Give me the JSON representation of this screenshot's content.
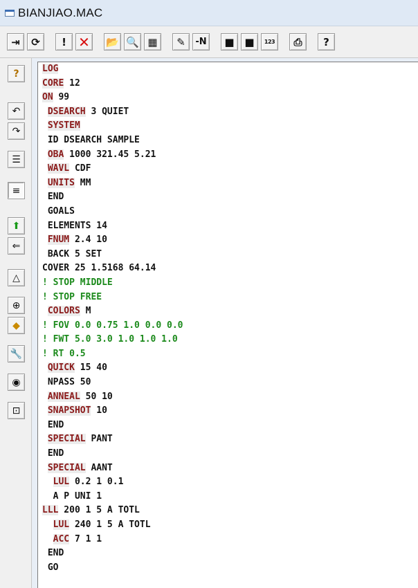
{
  "window": {
    "title": "BIANJIAO.MAC"
  },
  "toolbar": {
    "buttons": [
      {
        "name": "exit-button",
        "icon": "exit-icon",
        "glyph": "⇥",
        "cls": ""
      },
      {
        "name": "refresh-button",
        "icon": "refresh-icon",
        "glyph": "⟳",
        "cls": ""
      },
      {
        "name": "alert-button",
        "icon": "exclamation-icon",
        "glyph": "!",
        "cls": ""
      },
      {
        "name": "stop-button",
        "icon": "red-x-icon",
        "glyph": "✕",
        "cls": "red"
      },
      {
        "name": "open-folder-button",
        "icon": "open-folder-icon",
        "glyph": "📂",
        "cls": ""
      },
      {
        "name": "find-button",
        "icon": "magnifier-icon",
        "glyph": "🔍",
        "cls": ""
      },
      {
        "name": "macro-button",
        "icon": "macro-icon",
        "glyph": "▦",
        "cls": ""
      },
      {
        "name": "edit-button",
        "icon": "edit-icon",
        "glyph": "✎",
        "cls": ""
      },
      {
        "name": "line-number-button",
        "icon": "minus-n-icon",
        "glyph": "-N",
        "cls": "txt"
      },
      {
        "name": "save-button",
        "icon": "floppy-icon",
        "glyph": "■",
        "cls": ""
      },
      {
        "name": "save-as-button",
        "icon": "floppy-as-icon",
        "glyph": "■",
        "cls": ""
      },
      {
        "name": "numbers-button",
        "icon": "numbers-123-icon",
        "glyph": "123",
        "cls": "small"
      },
      {
        "name": "print-button",
        "icon": "printer-icon",
        "glyph": "⎙",
        "cls": ""
      },
      {
        "name": "help-button",
        "icon": "question-icon",
        "glyph": "?",
        "cls": ""
      }
    ]
  },
  "sidebar": {
    "buttons": [
      {
        "name": "help-button-side",
        "icon": "yellow-question-icon",
        "glyph": "?"
      },
      {
        "name": "undo-button",
        "icon": "undo-icon",
        "glyph": "↶"
      },
      {
        "name": "redo-button",
        "icon": "redo-icon",
        "glyph": "↷"
      },
      {
        "name": "indent-button",
        "icon": "indent-icon",
        "glyph": "☰"
      },
      {
        "name": "align-button",
        "icon": "align-lines-icon",
        "glyph": "≡"
      },
      {
        "name": "move-up-button",
        "icon": "green-up-arrow-icon",
        "glyph": "⬆"
      },
      {
        "name": "import-button",
        "icon": "import-icon",
        "glyph": "⇐"
      },
      {
        "name": "lens-button",
        "icon": "triangle-icon",
        "glyph": "△"
      },
      {
        "name": "target-button",
        "icon": "target-icon",
        "glyph": "⊕"
      },
      {
        "name": "gem-button",
        "icon": "gem-icon",
        "glyph": "◆"
      },
      {
        "name": "wrench-button",
        "icon": "wrench-icon",
        "glyph": "🔧"
      },
      {
        "name": "view-button",
        "icon": "eye-icon",
        "glyph": "◉"
      },
      {
        "name": "frame-button",
        "icon": "frame-icon",
        "glyph": "⊡"
      }
    ]
  },
  "editor": {
    "lines": [
      {
        "i": "",
        "k": "LOG",
        "r": "",
        "c": false
      },
      {
        "i": "",
        "k": "CORE",
        "r": " 12",
        "c": false
      },
      {
        "i": "",
        "k": "ON",
        "r": " 99",
        "c": false
      },
      {
        "i": " ",
        "k": "DSEARCH",
        "r": " 3 QUIET",
        "c": false
      },
      {
        "i": " ",
        "k": "SYSTEM",
        "r": "",
        "c": false
      },
      {
        "i": " ",
        "k": "",
        "r": "ID DSEARCH SAMPLE",
        "c": false
      },
      {
        "i": " ",
        "k": "OBA",
        "r": " 1000 321.45 5.21",
        "c": false
      },
      {
        "i": " ",
        "k": "WAVL",
        "r": " CDF",
        "c": false
      },
      {
        "i": " ",
        "k": "UNITS",
        "r": " MM",
        "c": false
      },
      {
        "i": " ",
        "k": "",
        "r": "END",
        "c": false
      },
      {
        "i": " ",
        "k": "",
        "r": "GOALS",
        "c": false
      },
      {
        "i": " ",
        "k": "",
        "r": "ELEMENTS 14",
        "c": false
      },
      {
        "i": " ",
        "k": "FNUM",
        "r": " 2.4 10",
        "c": false
      },
      {
        "i": " ",
        "k": "",
        "r": "BACK 5 SET",
        "c": false
      },
      {
        "i": "",
        "k": "",
        "r": "COVER 25 1.5168 64.14",
        "c": false
      },
      {
        "i": "",
        "k": "",
        "r": "! STOP MIDDLE",
        "c": true
      },
      {
        "i": "",
        "k": "",
        "r": "! STOP FREE",
        "c": true
      },
      {
        "i": " ",
        "k": "COLORS",
        "r": " M",
        "c": false
      },
      {
        "i": "",
        "k": "",
        "r": "! FOV 0.0 0.75 1.0 0.0 0.0",
        "c": true
      },
      {
        "i": "",
        "k": "",
        "r": "! FWT 5.0 3.0 1.0 1.0 1.0",
        "c": true
      },
      {
        "i": "",
        "k": "",
        "r": "! RT 0.5",
        "c": true
      },
      {
        "i": " ",
        "k": "QUICK",
        "r": " 15 40",
        "c": false
      },
      {
        "i": " ",
        "k": "",
        "r": "NPASS 50",
        "c": false
      },
      {
        "i": " ",
        "k": "ANNEAL",
        "r": " 50 10",
        "c": false
      },
      {
        "i": " ",
        "k": "SNAPSHOT",
        "r": " 10",
        "c": false
      },
      {
        "i": " ",
        "k": "",
        "r": "END",
        "c": false
      },
      {
        "i": " ",
        "k": "SPECIAL",
        "r": " PANT",
        "c": false
      },
      {
        "i": " ",
        "k": "",
        "r": "END",
        "c": false
      },
      {
        "i": " ",
        "k": "SPECIAL",
        "r": " AANT",
        "c": false
      },
      {
        "i": "  ",
        "k": "LUL",
        "r": " 0.2 1 0.1",
        "c": false
      },
      {
        "i": "  ",
        "k": "",
        "r": "A P UNI 1",
        "c": false
      },
      {
        "i": "",
        "k": "LLL",
        "r": " 200 1 5 A TOTL",
        "c": false
      },
      {
        "i": "  ",
        "k": "LUL",
        "r": " 240 1 5 A TOTL",
        "c": false
      },
      {
        "i": "  ",
        "k": "ACC",
        "r": " 7 1 1",
        "c": false
      },
      {
        "i": " ",
        "k": "",
        "r": "END",
        "c": false
      },
      {
        "i": " ",
        "k": "",
        "r": "GO",
        "c": false
      }
    ]
  }
}
